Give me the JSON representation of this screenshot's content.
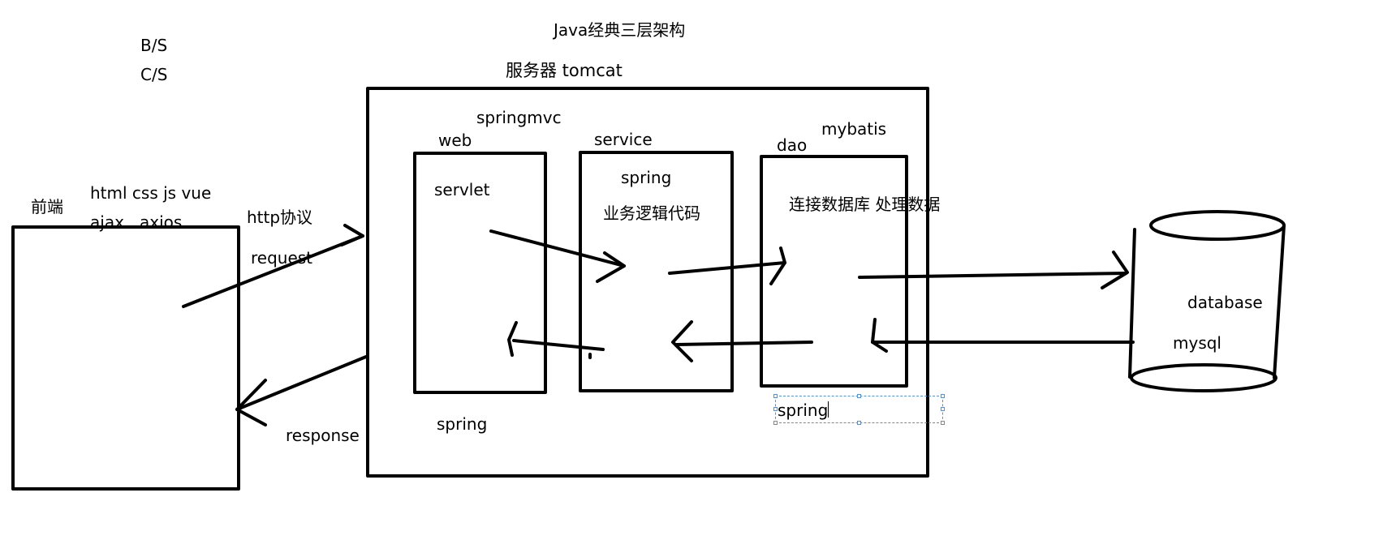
{
  "title": "Java经典三层架构",
  "arch_types": [
    "B/S",
    "C/S"
  ],
  "server_label": "服务器 tomcat",
  "frontend": {
    "label": "前端",
    "tech_line1": "html css js vue",
    "tech_line2": "ajax.. axios.."
  },
  "protocol": {
    "http": "http协议",
    "request": "request",
    "response": "response"
  },
  "web_layer": {
    "framework": "springmvc",
    "name": "web",
    "component": "servlet",
    "bottom_label": "spring"
  },
  "service_layer": {
    "name": "service",
    "framework": "spring",
    "description": "业务逻辑代码"
  },
  "dao_layer": {
    "name": "dao",
    "framework": "mybatis",
    "description": "连接数据库 处理数据",
    "editing_label": "spring"
  },
  "database": {
    "name": "database",
    "engine": "mysql"
  }
}
